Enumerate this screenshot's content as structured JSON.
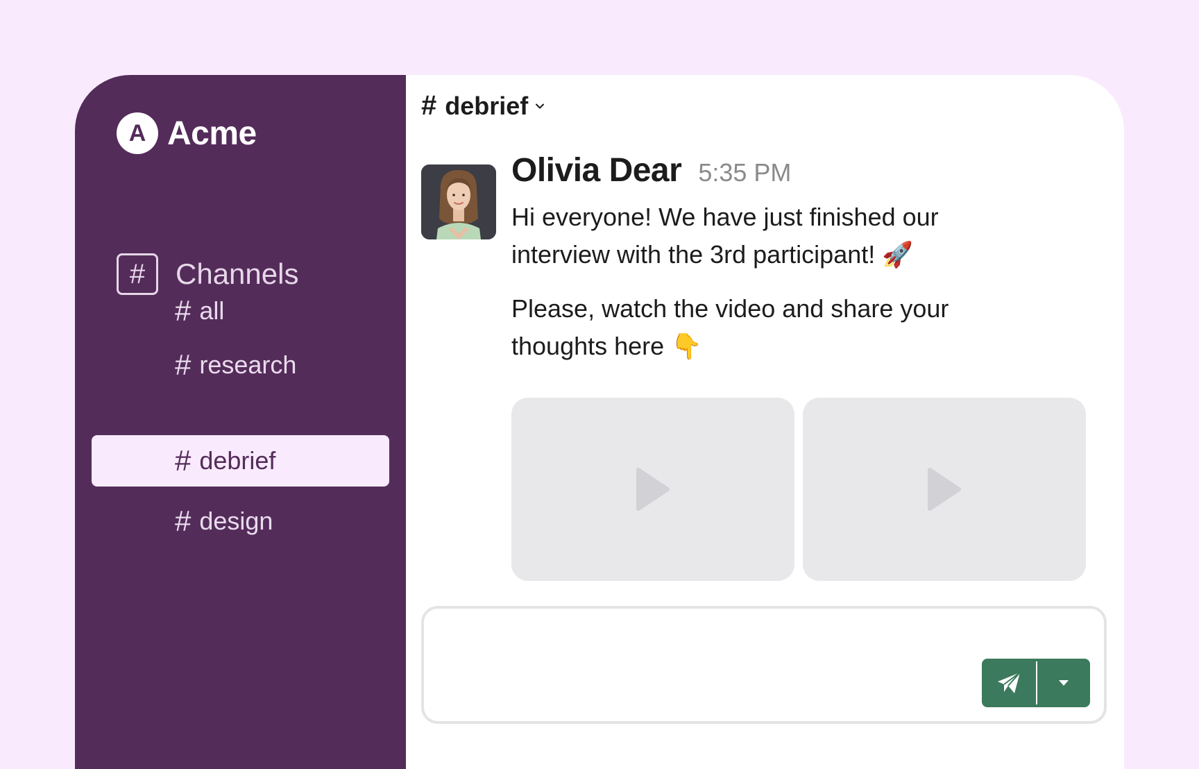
{
  "brand": {
    "logo_letter": "A",
    "name": "Acme"
  },
  "sidebar": {
    "section_icon_glyph": "#",
    "section_label": "Channels",
    "channels": [
      {
        "hash": "#",
        "label": "all",
        "active": false
      },
      {
        "hash": "#",
        "label": "research",
        "active": false
      },
      {
        "hash": "#",
        "label": "debrief",
        "active": true
      },
      {
        "hash": "#",
        "label": "design",
        "active": false
      }
    ]
  },
  "header": {
    "hash": "#",
    "channel": "debrief",
    "dropdown_icon": "chevron-down-icon"
  },
  "message": {
    "author": "Olivia Dear",
    "time": "5:35 PM",
    "paragraphs": [
      "Hi everyone! We have just finished our interview with the 3rd participant! 🚀",
      "Please, watch the video and share your thoughts here 👇"
    ],
    "attachments": [
      {
        "type": "video",
        "icon": "play-icon"
      },
      {
        "type": "video",
        "icon": "play-icon"
      }
    ]
  },
  "composer": {
    "placeholder": "",
    "send_icon": "paper-plane-icon",
    "more_icon": "caret-down-icon"
  },
  "colors": {
    "page_bg": "#f9ebfd",
    "sidebar_bg": "#542c5a",
    "active_channel_bg": "#f9ebfd",
    "send_button": "#3b7a5c",
    "video_placeholder": "#e8e8ea"
  }
}
